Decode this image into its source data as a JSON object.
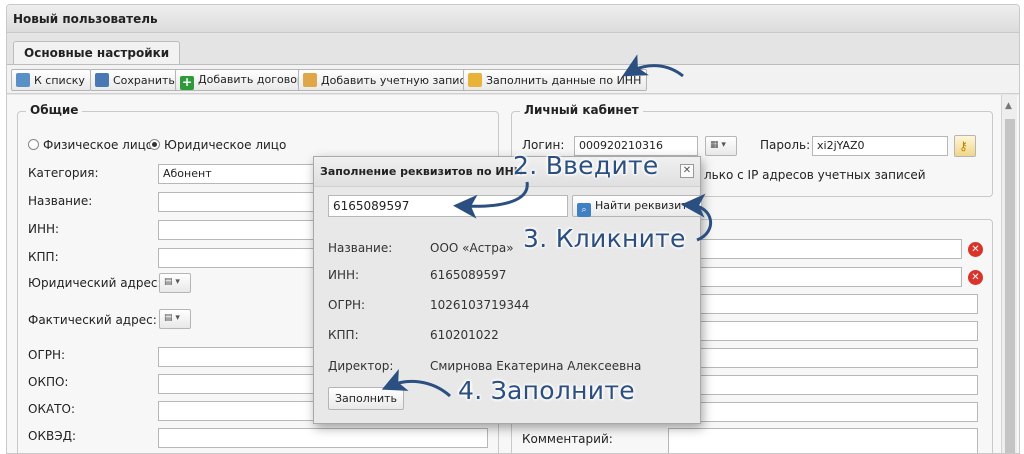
{
  "window": {
    "title": "Новый пользователь"
  },
  "tabs": [
    {
      "label": "Основные настройки",
      "active": true
    }
  ],
  "toolbar": {
    "to_list": "К списку",
    "save": "Сохранить",
    "add_contract": "Добавить договор",
    "add_account": "Добавить учетную запись",
    "fill_by_inn": "Заполнить данные по ИНН"
  },
  "general": {
    "legend": "Общие",
    "radio_individual": "Физическое лицо",
    "radio_legal": "Юридическое лицо",
    "category_label": "Категория:",
    "category_value": "Абонент",
    "name_label": "Название:",
    "inn_label": "ИНН:",
    "kpp_label": "КПП:",
    "legal_address_label": "Юридический адрес:",
    "actual_address_label": "Фактический адрес:",
    "ogrn_label": "ОГРН:",
    "okpo_label": "ОКПО:",
    "okato_label": "ОКАТО:",
    "okved_label": "ОКВЭД:"
  },
  "cabinet": {
    "legend": "Личный кабинет",
    "login_label": "Логин:",
    "login_value": "000920210316",
    "password_label": "Пароль:",
    "password_value": "xi2jYAZ0",
    "ip_note": "лько с IP адресов учетных записей",
    "comment_label": "Комментарий:"
  },
  "dialog": {
    "title": "Заполнение реквизитов по ИНН",
    "inn_input_value": "6165089597",
    "find_button": "Найти реквизиты",
    "fields": [
      {
        "label": "Название:",
        "value": "ООО «Астра»"
      },
      {
        "label": "ИНН:",
        "value": "6165089597"
      },
      {
        "label": "ОГРН:",
        "value": "1026103719344"
      },
      {
        "label": "КПП:",
        "value": "610201022"
      },
      {
        "label": "Директор:",
        "value": "Смирнова Екатерина Алексеевна"
      }
    ],
    "fill_button": "Заполнить"
  },
  "annotations": {
    "step2": "2. Введите",
    "step3": "3. Кликните",
    "step4": "4. Заполните"
  },
  "colors": {
    "annotation": "#2b4f80",
    "error": "#d9342b"
  }
}
